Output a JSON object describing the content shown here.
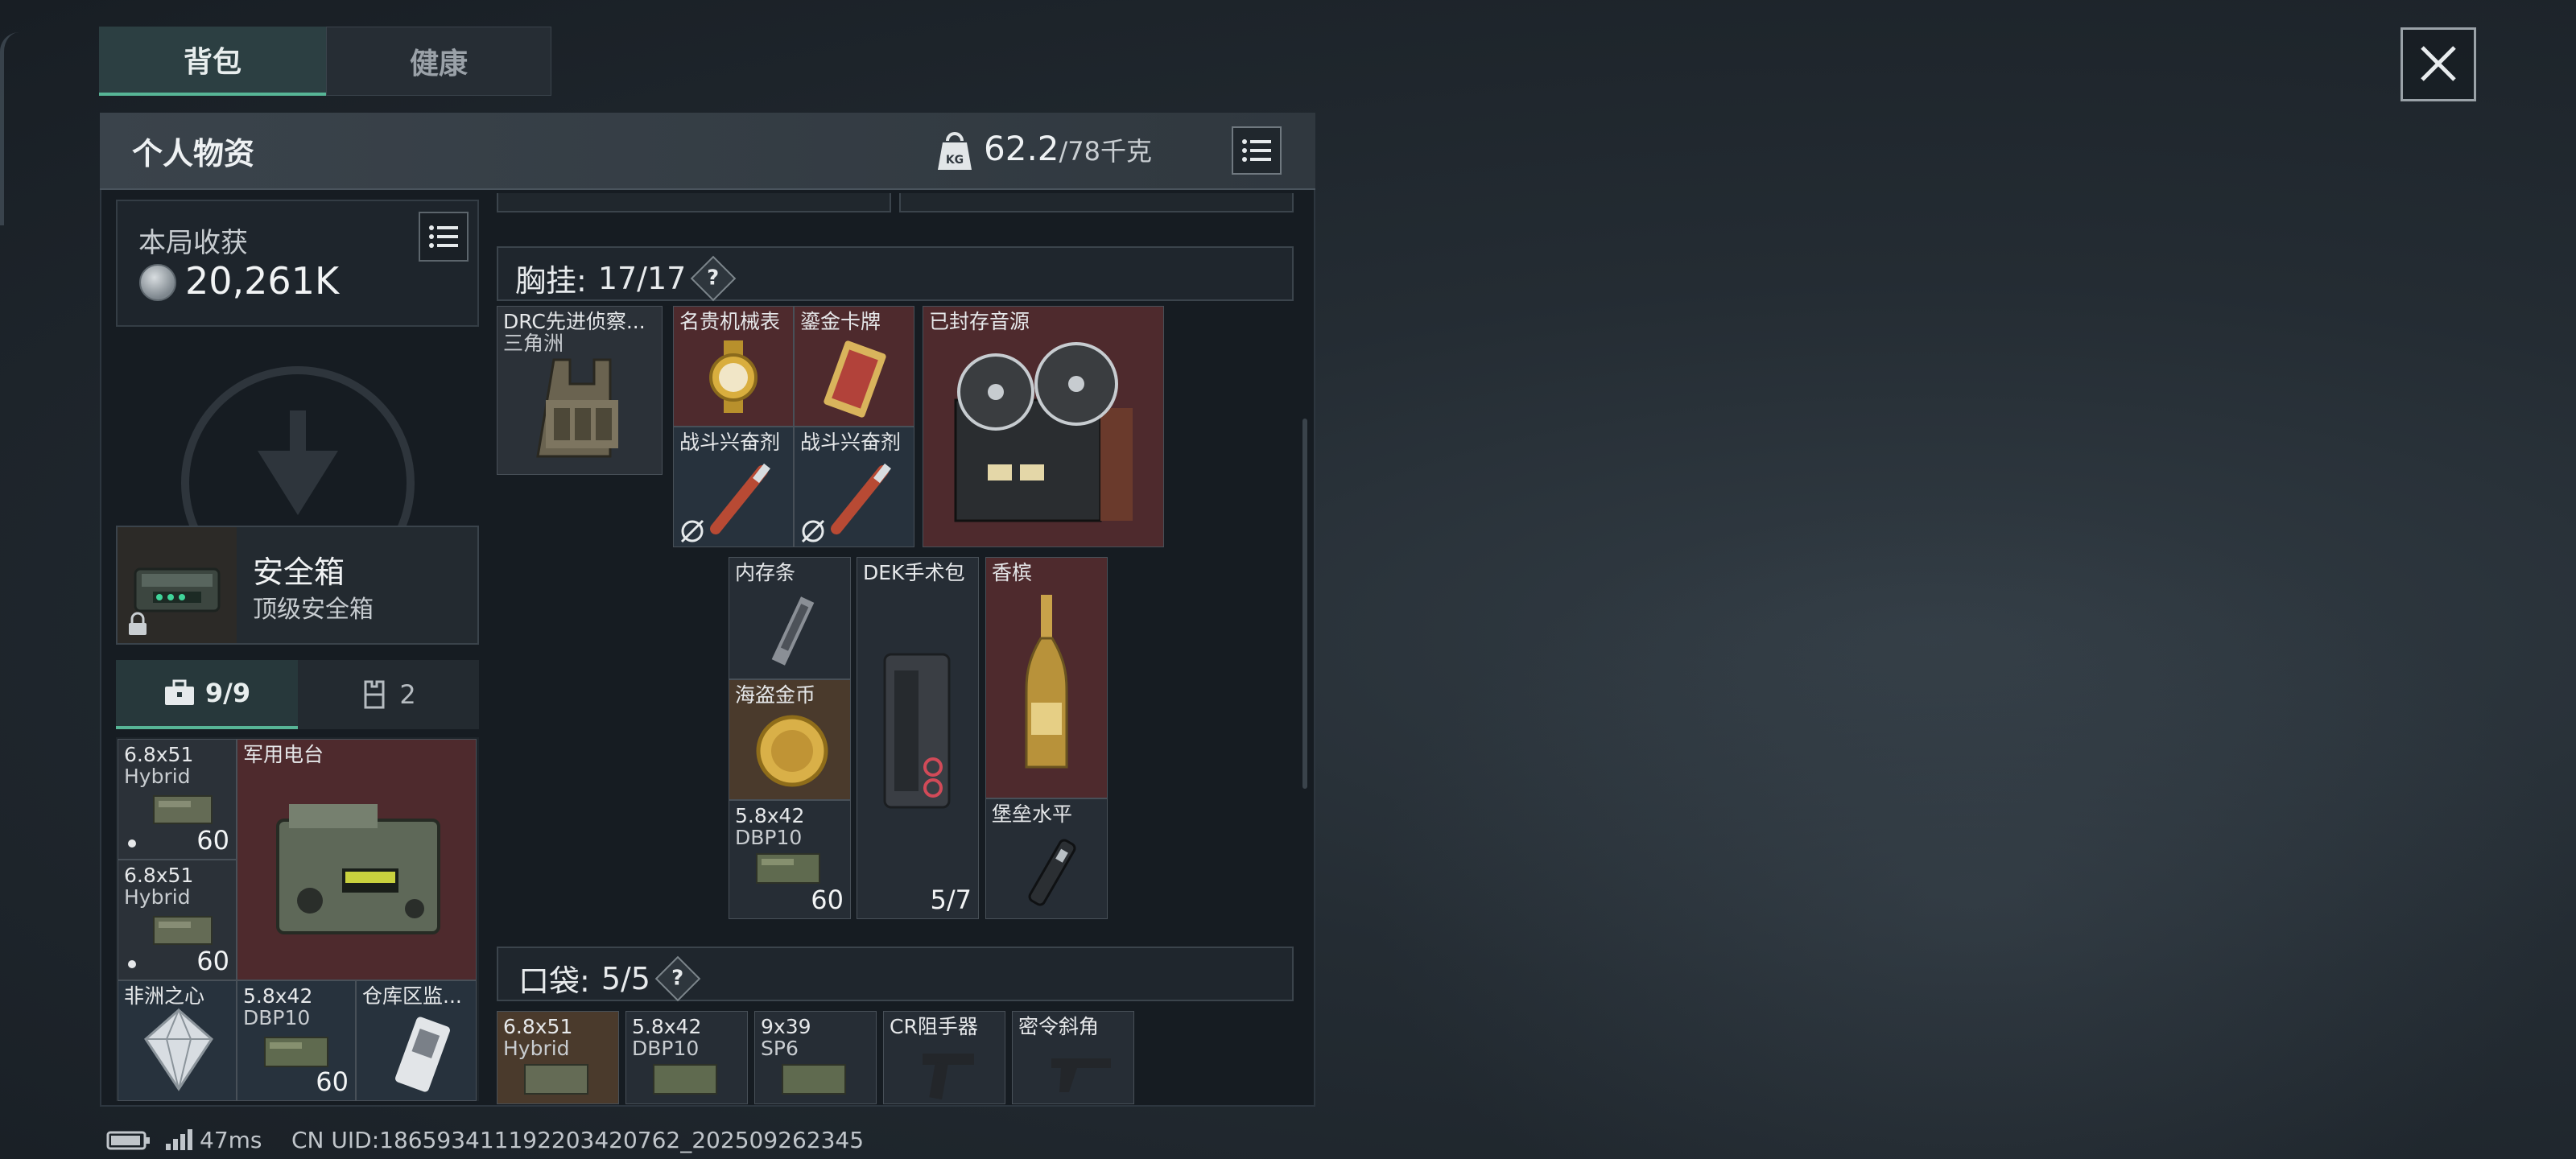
{
  "tabs": [
    {
      "label": "背包"
    },
    {
      "label": "健康"
    }
  ],
  "header": {
    "title": "个人物资",
    "weight_current": "62.2",
    "weight_max": "/78千克",
    "kg_icon_text": "KG"
  },
  "earnings": {
    "label": "本局收获",
    "value": "20,261K"
  },
  "safe_box": {
    "title": "安全箱",
    "subtitle": "顶级安全箱"
  },
  "container_tabs": [
    {
      "label": "9/9"
    },
    {
      "label": "2"
    }
  ],
  "safe_items": [
    {
      "name": "6.8x51",
      "sub": "Hybrid",
      "qty": "60"
    },
    {
      "name": "军用电台"
    },
    {
      "name": "6.8x51",
      "sub": "Hybrid",
      "qty": "60"
    },
    {
      "name": "非洲之心"
    },
    {
      "name": "5.8x42",
      "sub": "DBP10",
      "qty": "60"
    },
    {
      "name": "仓库区监..."
    }
  ],
  "chest_rig": {
    "label": "胸挂:",
    "count": "17/17",
    "help": "?"
  },
  "rig_items": [
    {
      "name": "DRC先进侦察...",
      "sub": "三角洲"
    },
    {
      "name": "名贵机械表"
    },
    {
      "name": "鎏金卡牌"
    },
    {
      "name": "已封存音源"
    },
    {
      "name": "战斗兴奋剂"
    },
    {
      "name": "战斗兴奋剂"
    },
    {
      "name": "内存条"
    },
    {
      "name": "DEK手术包",
      "qty": "5/7"
    },
    {
      "name": "香槟"
    },
    {
      "name": "海盗金币"
    },
    {
      "name": "5.8x42",
      "sub": "DBP10",
      "qty": "60"
    },
    {
      "name": "堡垒水平"
    }
  ],
  "pockets": {
    "label": "口袋:",
    "count": "5/5",
    "help": "?"
  },
  "pocket_items": [
    {
      "name": "6.8x51",
      "sub": "Hybrid"
    },
    {
      "name": "5.8x42",
      "sub": "DBP10"
    },
    {
      "name": "9x39",
      "sub": "SP6"
    },
    {
      "name": "CR阻手器"
    },
    {
      "name": "密令斜角"
    }
  ],
  "status": {
    "ping": "47ms",
    "uid": "CN UID:18659341119220342076​2_202509262345"
  },
  "colors": {
    "accent": "#57b596",
    "item_red": "#4e2a2d",
    "item_gold": "#4a3a2c",
    "item_blue": "#27323d"
  }
}
